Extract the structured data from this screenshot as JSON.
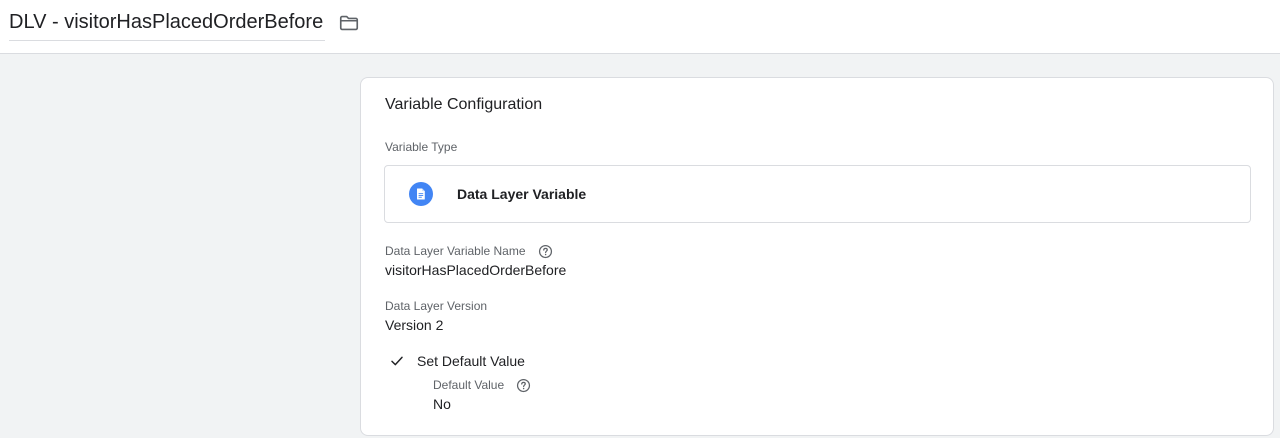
{
  "header": {
    "title": "DLV - visitorHasPlacedOrderBefore",
    "folder_icon": "folder-icon"
  },
  "card": {
    "title": "Variable Configuration",
    "variable_type_label": "Variable Type",
    "variable_type": {
      "icon": "document-icon",
      "name": "Data Layer Variable"
    },
    "dlv_name": {
      "label": "Data Layer Variable Name",
      "value": "visitorHasPlacedOrderBefore"
    },
    "dlv_version": {
      "label": "Data Layer Version",
      "value": "Version 2"
    },
    "default_value": {
      "checkbox_label": "Set Default Value",
      "label": "Default Value",
      "value": "No"
    }
  },
  "colors": {
    "accent": "#4285f4",
    "border": "#dadce0",
    "background": "#f1f3f4"
  }
}
